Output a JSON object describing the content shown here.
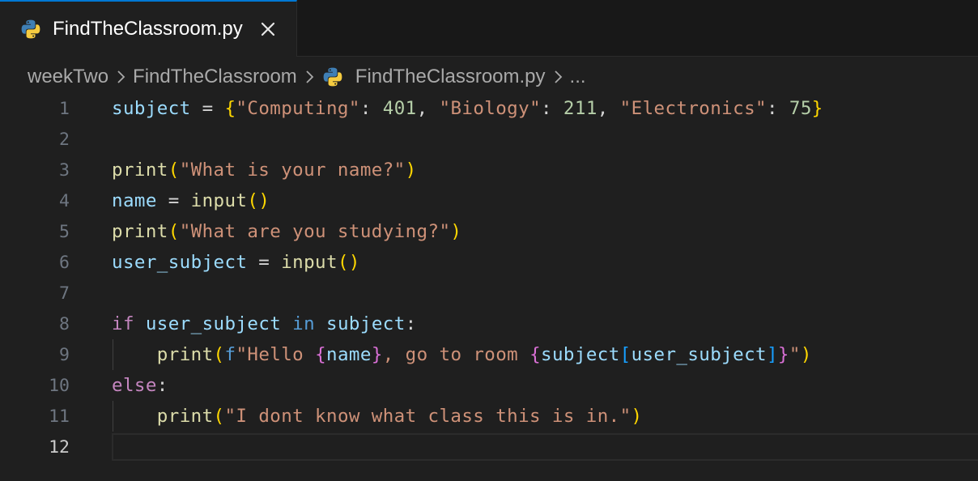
{
  "tab": {
    "file_name": "FindTheClassroom.py",
    "close_glyph": "✕",
    "icon": "python-icon"
  },
  "breadcrumb": {
    "items": [
      "weekTwo",
      "FindTheClassroom",
      "FindTheClassroom.py"
    ],
    "more": "..."
  },
  "colors": {
    "variable": "#9cdcfe",
    "function": "#dcdcaa",
    "string": "#ce9178",
    "number": "#b5cea8",
    "keyword_in": "#569cd6",
    "keyword_control": "#c586c0",
    "bracket_level_1": "#ffd700",
    "bracket_level_2": "#da70d6",
    "bracket_level_3": "#179fff",
    "tab_accent": "#0078d4",
    "background": "#1f1f1f"
  },
  "editor": {
    "active_line": "12",
    "line_numbers": [
      "1",
      "2",
      "3",
      "4",
      "5",
      "6",
      "7",
      "8",
      "9",
      "10",
      "11",
      "12"
    ],
    "l1": {
      "var": "subject",
      "eq": " = ",
      "ob": "{",
      "k1": "\"Computing\"",
      "c1": ": ",
      "v1": "401",
      "cm1": ", ",
      "k2": "\"Biology\"",
      "c2": ": ",
      "v2": "211",
      "cm2": ", ",
      "k3": "\"Electronics\"",
      "c3": ": ",
      "v3": "75",
      "cb": "}"
    },
    "l3": {
      "fn": "print",
      "op": "(",
      "str": "\"What is your name?\"",
      "cp": ")"
    },
    "l4": {
      "var": "name",
      "eq": " = ",
      "fn": "input",
      "parens": "()"
    },
    "l5": {
      "fn": "print",
      "op": "(",
      "str": "\"What are you studying?\"",
      "cp": ")"
    },
    "l6": {
      "var": "user_subject",
      "eq": " = ",
      "fn": "input",
      "parens": "()"
    },
    "l8": {
      "kw": "if",
      "sp1": " ",
      "var1": "user_subject",
      "sp2": " ",
      "kw_in": "in",
      "sp3": " ",
      "var2": "subject",
      "colon": ":"
    },
    "l9": {
      "indent": "    ",
      "fn": "print",
      "op": "(",
      "prefix": "f",
      "s1": "\"Hello ",
      "ob1": "{",
      "var1": "name",
      "cb1": "}",
      "s2": ", go to room ",
      "ob2": "{",
      "var2": "subject",
      "osq": "[",
      "var3": "user_subject",
      "csq": "]",
      "cb2": "}",
      "s3": "\"",
      "cp": ")"
    },
    "l10": {
      "kw": "else",
      "colon": ":"
    },
    "l11": {
      "indent": "    ",
      "fn": "print",
      "op": "(",
      "str": "\"I dont know what class this is in.\"",
      "cp": ")"
    }
  }
}
